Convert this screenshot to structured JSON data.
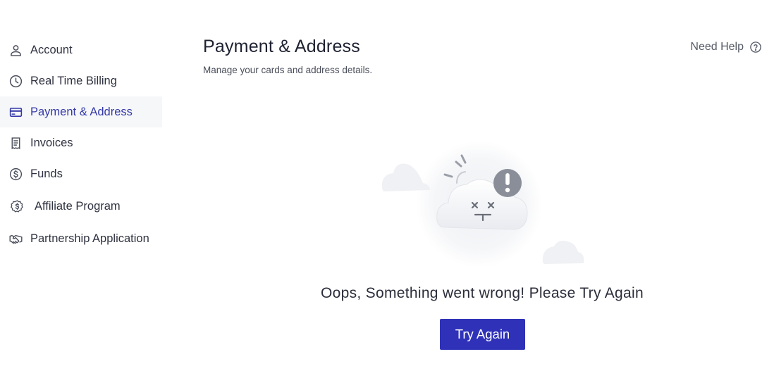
{
  "sidebar": {
    "items": [
      {
        "label": "Account",
        "icon": "user-icon"
      },
      {
        "label": "Real Time Billing",
        "icon": "clock-icon"
      },
      {
        "label": "Payment & Address",
        "icon": "credit-card-icon",
        "active": true
      },
      {
        "label": "Invoices",
        "icon": "receipt-icon"
      },
      {
        "label": "Funds",
        "icon": "dollar-circle-icon"
      },
      {
        "label": "Affiliate Program",
        "icon": "affiliate-badge-icon"
      },
      {
        "label": "Partnership Application",
        "icon": "handshake-icon"
      }
    ]
  },
  "header": {
    "title": "Payment & Address",
    "subtitle": "Manage your cards and address details.",
    "help_label": "Need Help"
  },
  "error": {
    "message": "Oops, Something went wrong! Please Try Again",
    "button_label": "Try Again"
  },
  "colors": {
    "accent": "#2f32b8",
    "active_text": "#353aa8",
    "active_bg": "#f6f7f9"
  }
}
